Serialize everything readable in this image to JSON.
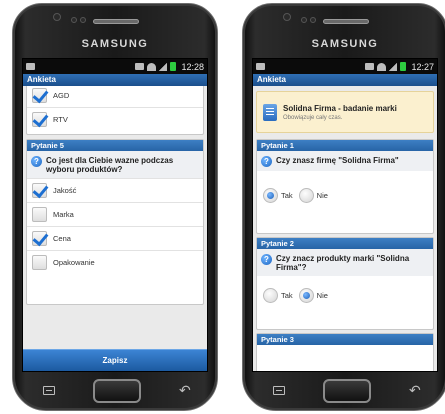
{
  "device": {
    "brand": "SAMSUNG"
  },
  "left_screen": {
    "status_time": "12:28",
    "app_title": "Ankieta",
    "prev_options": [
      {
        "label": "AGD",
        "checked": true
      },
      {
        "label": "RTV",
        "checked": true
      }
    ],
    "question_card": {
      "header": "Pytanie 5",
      "question": "Co jest dla Ciebie wazne podczas wyboru produktów?",
      "options": [
        {
          "label": "Jakość",
          "checked": true
        },
        {
          "label": "Marka",
          "checked": false
        },
        {
          "label": "Cena",
          "checked": true
        },
        {
          "label": "Opakowanie",
          "checked": false
        }
      ]
    },
    "save_label": "Zapisz"
  },
  "right_screen": {
    "status_time": "12:27",
    "app_title": "Ankieta",
    "notice": {
      "title": "Solidna Firma - badanie marki",
      "subtitle": "Obowiązuje cały czas."
    },
    "questions": [
      {
        "header": "Pytanie 1",
        "question": "Czy znasz firmę \"Solidna Firma\"",
        "options": [
          {
            "label": "Tak",
            "selected": true
          },
          {
            "label": "Nie",
            "selected": false
          }
        ]
      },
      {
        "header": "Pytanie 2",
        "question": "Czy znacz produkty marki \"Solidna Firma\"?",
        "options": [
          {
            "label": "Tak",
            "selected": false
          },
          {
            "label": "Nie",
            "selected": true
          }
        ]
      },
      {
        "header": "Pytanie 3"
      }
    ]
  }
}
